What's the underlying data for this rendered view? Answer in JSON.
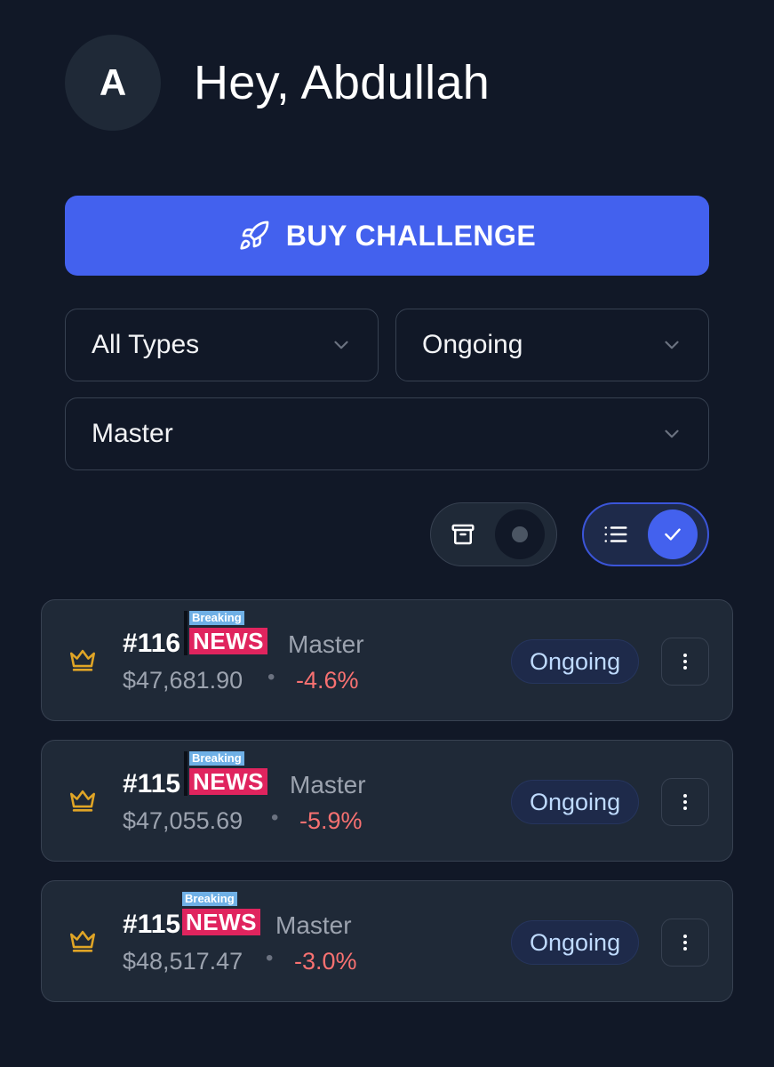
{
  "header": {
    "avatar_initial": "A",
    "greeting": "Hey, Abdullah"
  },
  "buy_button": {
    "label": "BUY CHALLENGE",
    "icon": "rocket-icon"
  },
  "filters": {
    "type": "All Types",
    "status": "Ongoing",
    "tier": "Master"
  },
  "toggles": {
    "archive_icon": "archive-icon",
    "list_icon": "list-icon",
    "check_icon": "check-icon"
  },
  "accounts": [
    {
      "id": "#116",
      "tier": "Master",
      "balance": "$47,681.90",
      "bullet": "•",
      "change": "-4.6%",
      "status": "Ongoing"
    },
    {
      "id": "#115",
      "tier": "Master",
      "balance": "$47,055.69",
      "bullet": "•",
      "change": "-5.9%",
      "status": "Ongoing"
    },
    {
      "id": "#115",
      "tier": "Master",
      "balance": "$48,517.47",
      "bullet": "•",
      "change": "-3.0%",
      "status": "Ongoing"
    }
  ],
  "news_overlay": {
    "breaking": "Breaking",
    "headline": "NEWS"
  },
  "colors": {
    "background": "#111827",
    "card": "#1f2937",
    "accent": "#4361ee",
    "negative": "#f87171",
    "crown": "#e0a526",
    "status_text": "#bfdbfe"
  }
}
